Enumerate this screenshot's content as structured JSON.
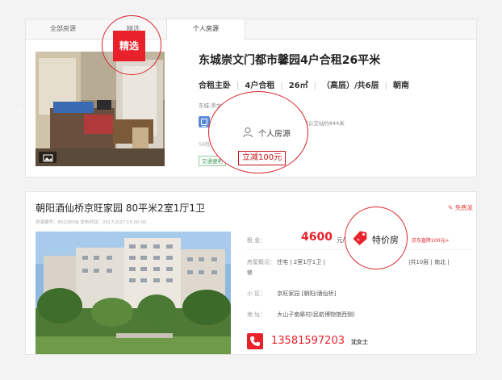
{
  "tabs": [
    "全部房源",
    "精选",
    "个人房源"
  ],
  "listing1": {
    "badge": "精选",
    "title": "东城崇文门都市馨园4户合租26平米",
    "specs": [
      "合租主卧",
      "4户合租",
      "26㎡",
      "（高层）/共6层",
      "朝南"
    ],
    "location": "东城-崇文门-都市馨园",
    "subway": "距7号线崇文门站/地铁同仁医院外东分院公交站约844米",
    "refresh": "56秒前更新",
    "tag": "交通便利",
    "personal_label": "个人房源",
    "discount": "立减100元"
  },
  "listing2": {
    "title": "朝阳酒仙桥京旺家园 80平米2室1厅1卫",
    "meta": "房源编号：6522839J    发布时间：2017/2/27 15:00:00",
    "report": "免费发",
    "price_label": "租    金：",
    "price": "4600",
    "price_unit": "元/月|面议",
    "jd_link": "京东直降100元>",
    "overview_label": "房屋概况：",
    "overview": "住宅  |  2室1厅1卫  |  ",
    "overview_floor": "|共10层  |  南北  |",
    "overview_extra": "修",
    "community_label": "小    区：",
    "community": "京旺家园 [朝阳/酒仙桥]",
    "address_label": "地    址：",
    "address": "大山子南皋村(民航博物馆西侧)",
    "phone": "13581597203",
    "contact": "沈女士",
    "special_label": "特价房"
  },
  "colors": {
    "accent": "#e8212b",
    "green_tag": "#3a9b54"
  },
  "icons": [
    "image-icon",
    "subway-icon",
    "person-icon",
    "phone-icon",
    "price-tag-icon",
    "edit-icon",
    "chevron-left-icon"
  ]
}
